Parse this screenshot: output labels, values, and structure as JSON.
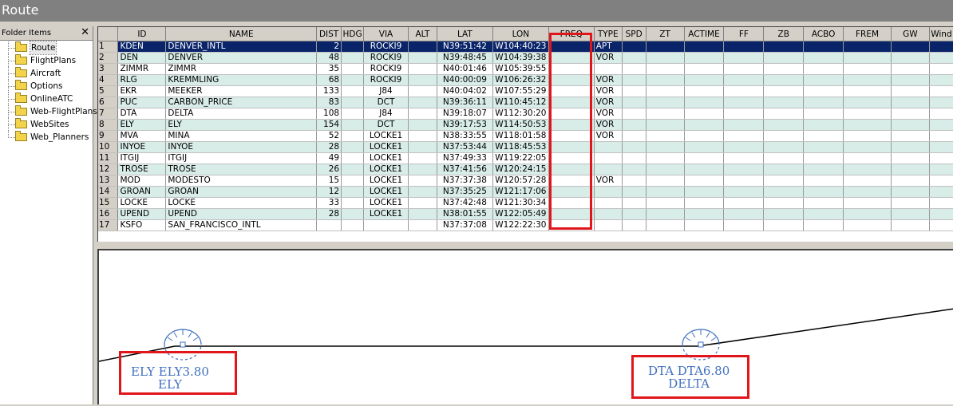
{
  "window": {
    "title": "Route"
  },
  "left_pane": {
    "header": "Folder Items",
    "close_glyph": "✕",
    "items": [
      {
        "label": "Route",
        "selected": true
      },
      {
        "label": "FlightPlans"
      },
      {
        "label": "Aircraft"
      },
      {
        "label": "Options"
      },
      {
        "label": "OnlineATC"
      },
      {
        "label": "Web-FlightPlans"
      },
      {
        "label": "WebSites"
      },
      {
        "label": "Web_Planners"
      }
    ]
  },
  "grid": {
    "columns": [
      "",
      "ID",
      "NAME",
      "DIST",
      "HDG",
      "VIA",
      "ALT",
      "LAT",
      "LON",
      "FREQ",
      "TYPE",
      "SPD",
      "ZT",
      "ACTIME",
      "FF",
      "ZB",
      "ACBO",
      "FREM",
      "GW",
      "Wind"
    ],
    "rows": [
      [
        "1",
        "KDEN",
        "DENVER_INTL",
        "2",
        "",
        "ROCKI9",
        "",
        "N39:51:42",
        "W104:40:23",
        "",
        "APT"
      ],
      [
        "2",
        "DEN",
        "DENVER",
        "48",
        "",
        "ROCKI9",
        "",
        "N39:48:45",
        "W104:39:38",
        "",
        "VOR"
      ],
      [
        "3",
        "ZIMMR",
        "ZIMMR",
        "35",
        "",
        "ROCKI9",
        "",
        "N40:01:46",
        "W105:39:55",
        "",
        ""
      ],
      [
        "4",
        "RLG",
        "KREMMLING",
        "68",
        "",
        "ROCKI9",
        "",
        "N40:00:09",
        "W106:26:32",
        "",
        "VOR"
      ],
      [
        "5",
        "EKR",
        "MEEKER",
        "133",
        "",
        "J84",
        "",
        "N40:04:02",
        "W107:55:29",
        "",
        "VOR"
      ],
      [
        "6",
        "PUC",
        "CARBON_PRICE",
        "83",
        "",
        "DCT",
        "",
        "N39:36:11",
        "W110:45:12",
        "",
        "VOR"
      ],
      [
        "7",
        "DTA",
        "DELTA",
        "108",
        "",
        "J84",
        "",
        "N39:18:07",
        "W112:30:20",
        "",
        "VOR"
      ],
      [
        "8",
        "ELY",
        "ELY",
        "154",
        "",
        "DCT",
        "",
        "N39:17:53",
        "W114:50:53",
        "",
        "VOR"
      ],
      [
        "9",
        "MVA",
        "MINA",
        "52",
        "",
        "LOCKE1",
        "",
        "N38:33:55",
        "W118:01:58",
        "",
        "VOR"
      ],
      [
        "10",
        "INYOE",
        "INYOE",
        "28",
        "",
        "LOCKE1",
        "",
        "N37:53:44",
        "W118:45:53",
        "",
        ""
      ],
      [
        "11",
        "ITGIJ",
        "ITGIJ",
        "49",
        "",
        "LOCKE1",
        "",
        "N37:49:33",
        "W119:22:05",
        "",
        ""
      ],
      [
        "12",
        "TROSE",
        "TROSE",
        "26",
        "",
        "LOCKE1",
        "",
        "N37:41:56",
        "W120:24:15",
        "",
        ""
      ],
      [
        "13",
        "MOD",
        "MODESTO",
        "15",
        "",
        "LOCKE1",
        "",
        "N37:37:38",
        "W120:57:28",
        "",
        "VOR"
      ],
      [
        "14",
        "GROAN",
        "GROAN",
        "12",
        "",
        "LOCKE1",
        "",
        "N37:35:25",
        "W121:17:06",
        "",
        ""
      ],
      [
        "15",
        "LOCKE",
        "LOCKE",
        "33",
        "",
        "LOCKE1",
        "",
        "N37:42:48",
        "W121:30:34",
        "",
        ""
      ],
      [
        "16",
        "UPEND",
        "UPEND",
        "28",
        "",
        "LOCKE1",
        "",
        "N38:01:55",
        "W122:05:49",
        "",
        ""
      ],
      [
        "17",
        "KSFO",
        "SAN_FRANCISCO_INTL",
        "",
        "",
        "",
        "",
        "N37:37:08",
        "W122:22:30",
        "",
        ""
      ]
    ]
  },
  "map": {
    "waypoints": [
      {
        "id": "ely",
        "line1": "ELY ELY3.80",
        "line2": "ELY"
      },
      {
        "id": "dta",
        "line1": "DTA DTA6.80",
        "line2": "DELTA"
      }
    ]
  },
  "colors": {
    "selection": "#0a246a",
    "row_alt": "#d8ece8",
    "highlight_box": "#e0161b",
    "map_label": "#3f6fc0",
    "vor_symbol": "#3f6fc0"
  }
}
